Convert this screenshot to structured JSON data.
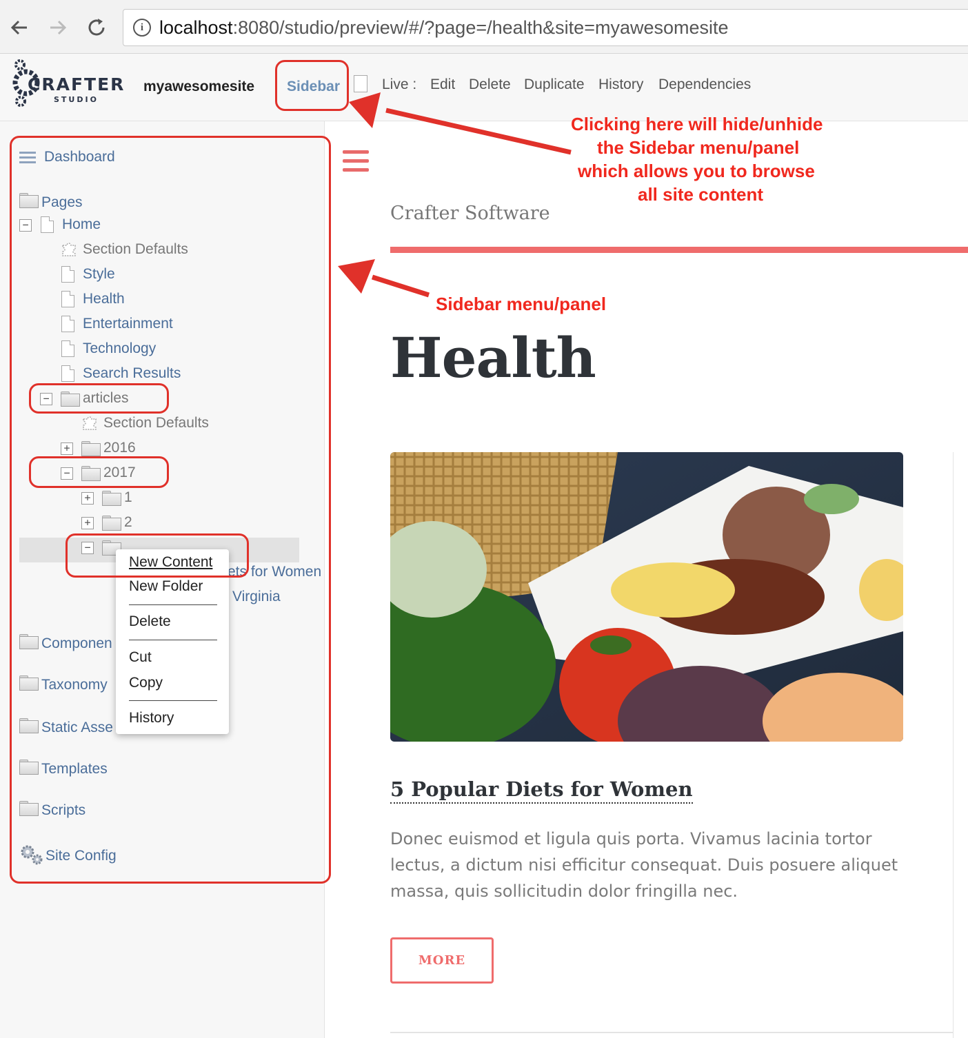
{
  "browser": {
    "url_host": "localhost",
    "url_rest": ":8080/studio/preview/#/?page=/health&site=myawesomesite"
  },
  "studio": {
    "logo_text": "CRAFTER",
    "logo_sub": "STUDIO",
    "site_name": "myawesomesite",
    "sidebar_label": "Sidebar",
    "toolbar": [
      "Live :",
      "Edit",
      "Delete",
      "Duplicate",
      "History",
      "Dependencies"
    ]
  },
  "sidebar": {
    "dashboard": "Dashboard",
    "pages": "Pages",
    "home": "Home",
    "home_children": [
      "Section Defaults",
      "Style",
      "Health",
      "Entertainment",
      "Technology",
      "Search Results"
    ],
    "articles": "articles",
    "articles_section_defaults": "Section Defaults",
    "year_2016": "2016",
    "year_2017": "2017",
    "month_1": "1",
    "month_2": "2",
    "partial_women": "ets for Women",
    "partial_virginia": "Virginia",
    "components": "Componen",
    "taxonomy": "Taxonomy",
    "static_assets": "Static Asse",
    "templates": "Templates",
    "scripts": "Scripts",
    "site_config": "Site Config"
  },
  "context_menu": {
    "new_content": "New Content",
    "new_folder": "New Folder",
    "delete": "Delete",
    "cut": "Cut",
    "copy": "Copy",
    "history": "History"
  },
  "preview": {
    "brand": "Crafter Software",
    "heading": "Health",
    "article_title": "5 Popular Diets for Women",
    "article_body": "Donec euismod et ligula quis porta. Vivamus lacinia tortor lectus, a dictum nisi efficitur consequat. Duis posuere aliquet massa, quis sollicitudin dolor fringilla nec.",
    "more_label": "MORE"
  },
  "annotations": {
    "sidebar_toggle_note": [
      "Clicking here will hide/unhide",
      "the Sidebar menu/panel",
      "which allows you to browse",
      "all site content"
    ],
    "panel_note": "Sidebar menu/panel"
  },
  "colors": {
    "accent_red": "#ef6c6c",
    "annotation_red": "#f0281e",
    "link_blue": "#4a6d99"
  }
}
